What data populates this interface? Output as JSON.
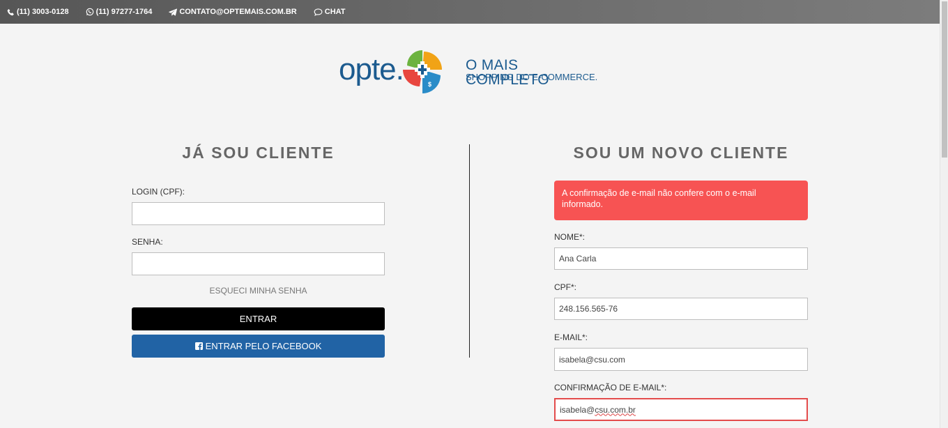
{
  "topbar": {
    "phone": "(11) 3003-0128",
    "whatsapp": "(11) 97277-1764",
    "email": "CONTATO@OPTEMAIS.COM.BR",
    "chat": "CHAT"
  },
  "brand": {
    "logo_text": "opte.",
    "tagline_line1": "O MAIS COMPLETO",
    "tagline_line2": "SHOPPING DO E-COMMERCE.",
    "color": "#1c5b8f"
  },
  "login": {
    "title": "JÁ SOU CLIENTE",
    "login_label": "LOGIN (CPF):",
    "login_value": "",
    "password_label": "SENHA:",
    "password_value": "",
    "forgot_label": "ESQUECI MINHA SENHA",
    "submit_label": "ENTRAR",
    "facebook_label": "ENTRAR PELO FACEBOOK"
  },
  "register": {
    "title": "SOU UM NOVO CLIENTE",
    "alert": "A confirmação de e-mail não confere com o e-mail informado.",
    "alert_color": "#f75353",
    "name_label": "NOME*:",
    "name_value": "Ana Carla",
    "cpf_label": "CPF*:",
    "cpf_value": "248.156.565-76",
    "email_label": "E-MAIL*:",
    "email_value": "isabela@csu.com",
    "confirm_label": "CONFIRMAÇÃO DE E-MAIL*:",
    "confirm_value_prefix": "isabela@",
    "confirm_value_typo": "csu.com.br"
  }
}
